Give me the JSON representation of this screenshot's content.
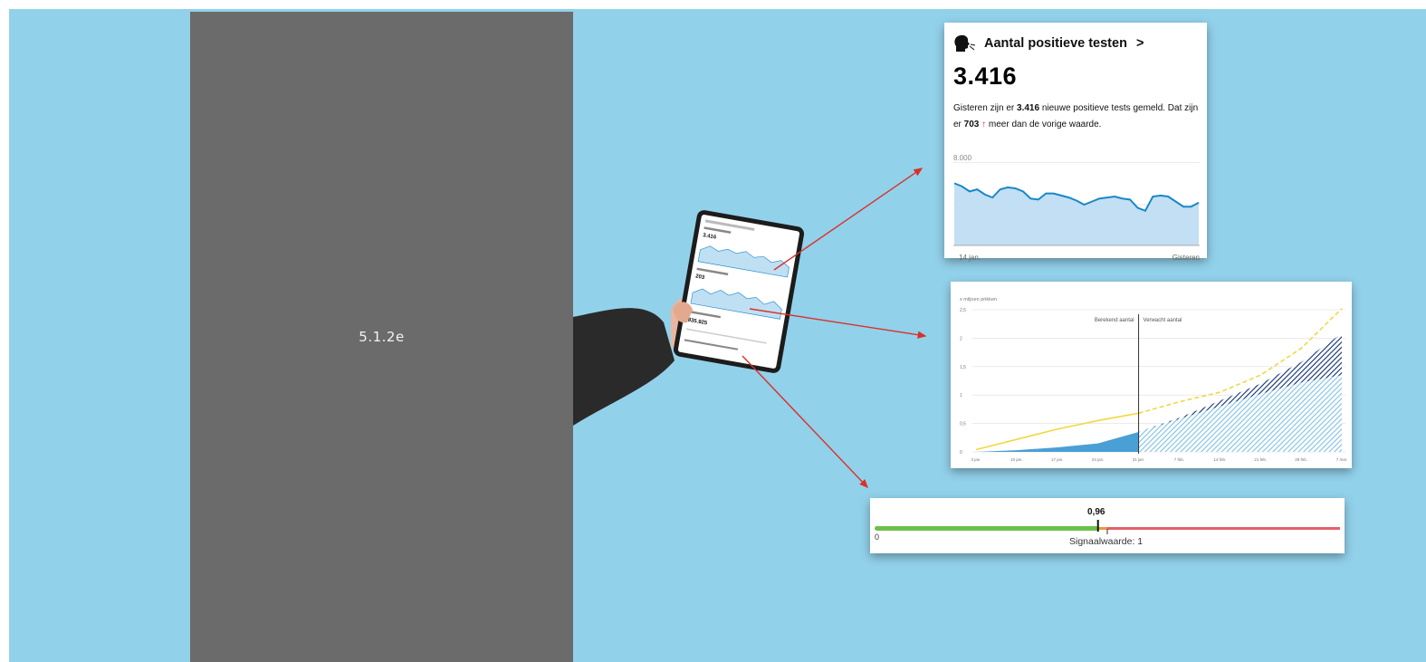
{
  "redaction": {
    "label": "5.1.2e",
    "color": "#6b6b6b"
  },
  "background_color": "#92d1ea",
  "arrow_color": "#d9302a",
  "tests_card": {
    "title": "Aantal positieve testen",
    "chevron": ">",
    "icon": "person-coughing-icon",
    "value": "3.416",
    "desc_part1": "Gisteren zijn er ",
    "desc_bold1": "3.416",
    "desc_part2": " nieuwe positieve tests gemeld. Dat zijn er ",
    "desc_bold2": "703",
    "desc_arrow": "↑",
    "desc_part3": " meer dan de vorige waarde.",
    "chart_data": {
      "type": "area",
      "y_max_label": "8.000",
      "x_start_label": "14 jan.",
      "x_end_label": "Gisteren",
      "ylim": [
        0,
        8000
      ],
      "line_color": "#1a87c8",
      "fill_color": "#c2dff3",
      "values": [
        6100,
        5800,
        5300,
        5500,
        5000,
        4700,
        5500,
        5700,
        5600,
        5300,
        4600,
        4500,
        5100,
        5100,
        4900,
        4700,
        4400,
        4000,
        4300,
        4600,
        4700,
        4800,
        4600,
        4500,
        3700,
        3400,
        4800,
        4900,
        4800,
        4300,
        3800,
        3800,
        4200
      ]
    }
  },
  "vacc_card": {
    "chart_data": {
      "type": "area",
      "ylabel": "x miljoen prikken",
      "ylim": [
        0,
        2.5
      ],
      "y_ticks": [
        "0",
        "0,5",
        "1",
        "1,5",
        "2",
        "2,5"
      ],
      "x_ticks": [
        "3 jan.",
        "10 jan.",
        "17 jan.",
        "24 jan.",
        "31 jan.",
        "7 feb.",
        "14 feb.",
        "21 feb.",
        "28 feb.",
        "7 mar."
      ],
      "divider_label_left": "Berekend aantal",
      "divider_label_right": "Verwacht aantal",
      "series": [
        {
          "style": "solid",
          "color": "#f0d940",
          "x": [
            0,
            1,
            2,
            3,
            4
          ],
          "values": [
            0.04,
            0.22,
            0.4,
            0.55,
            0.68
          ]
        },
        {
          "style": "dashed",
          "color": "#f0d940",
          "x": [
            4,
            5,
            6,
            7,
            8,
            9
          ],
          "values": [
            0.68,
            0.88,
            1.05,
            1.35,
            1.82,
            2.52
          ]
        },
        {
          "style": "area",
          "color": "#4a9fd5",
          "x": [
            0,
            1,
            2,
            3,
            4
          ],
          "values": [
            0.0,
            0.03,
            0.08,
            0.15,
            0.35
          ]
        },
        {
          "style": "hatched-area",
          "color": "#7fc0e6",
          "x": [
            4,
            5,
            6,
            7,
            8,
            9
          ],
          "values": [
            0.35,
            0.58,
            0.8,
            1.02,
            1.22,
            1.35
          ]
        },
        {
          "style": "hatched-area",
          "color": "#0f2f6e",
          "x": [
            4,
            5,
            6,
            7,
            8,
            9
          ],
          "values": [
            0.35,
            0.6,
            0.9,
            1.2,
            1.58,
            2.08
          ]
        }
      ]
    }
  },
  "repro_card": {
    "value_label": "0,96",
    "value": 0.96,
    "zero_label": "0",
    "signal_label": "Signaalwaarde: 1",
    "signal_value": 1,
    "scale_max": 2,
    "green": "#6cc04a",
    "red": "#e5606a",
    "orange": "#e89a3a"
  },
  "tablet": {
    "device": "tablet-icon",
    "screen_value_1": "3.416",
    "screen_value_2": "203",
    "screen_value_3": "835.925"
  }
}
